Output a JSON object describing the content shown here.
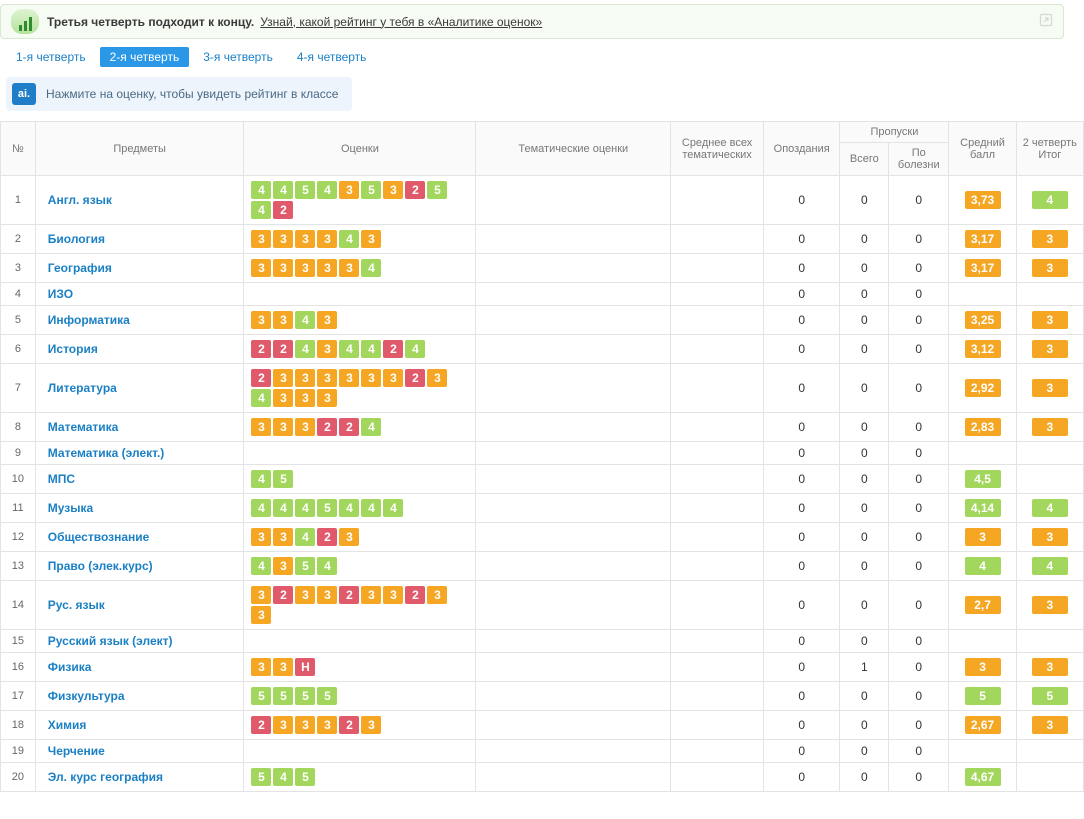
{
  "banner": {
    "title": "Третья четверть подходит к концу.",
    "link": "Узнай, какой рейтинг у тебя в «Аналитике оценок»"
  },
  "tabs": [
    "1-я четверть",
    "2-я четверть",
    "3-я четверть",
    "4-я четверть"
  ],
  "activeTab": 1,
  "tip": {
    "icon": "ai.",
    "text": "Нажмите на оценку, чтобы увидеть рейтинг в классе"
  },
  "headers": {
    "num": "№",
    "subjects": "Предметы",
    "marks": "Оценки",
    "thematic": "Тематические оценки",
    "avgThematic": "Среднее всех тематических",
    "late": "Опоздания",
    "absences": "Пропуски",
    "absTotal": "Всего",
    "absIll": "По болезни",
    "avg": "Средний балл",
    "final": "2 четверть Итог"
  },
  "rows": [
    {
      "n": 1,
      "subject": "Англ. язык",
      "marks": [
        "4",
        "4",
        "5",
        "4",
        "3",
        "5",
        "3",
        "2",
        "5",
        "4",
        "2"
      ],
      "late": 0,
      "absTotal": 0,
      "absIll": 0,
      "avg": "3,73",
      "avgColor": "orange",
      "final": "4",
      "finalColor": "green"
    },
    {
      "n": 2,
      "subject": "Биология",
      "marks": [
        "3",
        "3",
        "3",
        "3",
        "4",
        "3"
      ],
      "late": 0,
      "absTotal": 0,
      "absIll": 0,
      "avg": "3,17",
      "avgColor": "orange",
      "final": "3",
      "finalColor": "orange"
    },
    {
      "n": 3,
      "subject": "География",
      "marks": [
        "3",
        "3",
        "3",
        "3",
        "3",
        "4"
      ],
      "late": 0,
      "absTotal": 0,
      "absIll": 0,
      "avg": "3,17",
      "avgColor": "orange",
      "final": "3",
      "finalColor": "orange"
    },
    {
      "n": 4,
      "subject": "ИЗО",
      "marks": [],
      "late": 0,
      "absTotal": 0,
      "absIll": 0,
      "avg": "",
      "avgColor": "",
      "final": "",
      "finalColor": ""
    },
    {
      "n": 5,
      "subject": "Информатика",
      "marks": [
        "3",
        "3",
        "4",
        "3"
      ],
      "late": 0,
      "absTotal": 0,
      "absIll": 0,
      "avg": "3,25",
      "avgColor": "orange",
      "final": "3",
      "finalColor": "orange"
    },
    {
      "n": 6,
      "subject": "История",
      "marks": [
        "2",
        "2",
        "4",
        "3",
        "4",
        "4",
        "2",
        "4"
      ],
      "late": 0,
      "absTotal": 0,
      "absIll": 0,
      "avg": "3,12",
      "avgColor": "orange",
      "final": "3",
      "finalColor": "orange"
    },
    {
      "n": 7,
      "subject": "Литература",
      "marks": [
        "2",
        "3",
        "3",
        "3",
        "3",
        "3",
        "3",
        "2",
        "3",
        "4",
        "3",
        "3",
        "3"
      ],
      "late": 0,
      "absTotal": 0,
      "absIll": 0,
      "avg": "2,92",
      "avgColor": "orange",
      "final": "3",
      "finalColor": "orange"
    },
    {
      "n": 8,
      "subject": "Математика",
      "marks": [
        "3",
        "3",
        "3",
        "2",
        "2",
        "4"
      ],
      "late": 0,
      "absTotal": 0,
      "absIll": 0,
      "avg": "2,83",
      "avgColor": "orange",
      "final": "3",
      "finalColor": "orange"
    },
    {
      "n": 9,
      "subject": "Математика (элект.)",
      "marks": [],
      "late": 0,
      "absTotal": 0,
      "absIll": 0,
      "avg": "",
      "avgColor": "",
      "final": "",
      "finalColor": ""
    },
    {
      "n": 10,
      "subject": "МПС",
      "marks": [
        "4",
        "5"
      ],
      "late": 0,
      "absTotal": 0,
      "absIll": 0,
      "avg": "4,5",
      "avgColor": "green",
      "final": "",
      "finalColor": ""
    },
    {
      "n": 11,
      "subject": "Музыка",
      "marks": [
        "4",
        "4",
        "4",
        "5",
        "4",
        "4",
        "4"
      ],
      "late": 0,
      "absTotal": 0,
      "absIll": 0,
      "avg": "4,14",
      "avgColor": "green",
      "final": "4",
      "finalColor": "green"
    },
    {
      "n": 12,
      "subject": "Обществознание",
      "marks": [
        "3",
        "3",
        "4",
        "2",
        "3"
      ],
      "late": 0,
      "absTotal": 0,
      "absIll": 0,
      "avg": "3",
      "avgColor": "orange",
      "final": "3",
      "finalColor": "orange"
    },
    {
      "n": 13,
      "subject": "Право (элек.курс)",
      "marks": [
        "4",
        "3",
        "5",
        "4"
      ],
      "late": 0,
      "absTotal": 0,
      "absIll": 0,
      "avg": "4",
      "avgColor": "green",
      "final": "4",
      "finalColor": "green"
    },
    {
      "n": 14,
      "subject": "Рус. язык",
      "marks": [
        "3",
        "2",
        "3",
        "3",
        "2",
        "3",
        "3",
        "2",
        "3",
        "3"
      ],
      "late": 0,
      "absTotal": 0,
      "absIll": 0,
      "avg": "2,7",
      "avgColor": "orange",
      "final": "3",
      "finalColor": "orange"
    },
    {
      "n": 15,
      "subject": "Русский язык (элект)",
      "marks": [],
      "late": 0,
      "absTotal": 0,
      "absIll": 0,
      "avg": "",
      "avgColor": "",
      "final": "",
      "finalColor": ""
    },
    {
      "n": 16,
      "subject": "Физика",
      "marks": [
        "3",
        "3",
        "Н"
      ],
      "late": 0,
      "absTotal": 1,
      "absIll": 0,
      "avg": "3",
      "avgColor": "orange",
      "final": "3",
      "finalColor": "orange"
    },
    {
      "n": 17,
      "subject": "Физкультура",
      "marks": [
        "5",
        "5",
        "5",
        "5"
      ],
      "late": 0,
      "absTotal": 0,
      "absIll": 0,
      "avg": "5",
      "avgColor": "green",
      "final": "5",
      "finalColor": "green"
    },
    {
      "n": 18,
      "subject": "Химия",
      "marks": [
        "2",
        "3",
        "3",
        "3",
        "2",
        "3"
      ],
      "late": 0,
      "absTotal": 0,
      "absIll": 0,
      "avg": "2,67",
      "avgColor": "orange",
      "final": "3",
      "finalColor": "orange"
    },
    {
      "n": 19,
      "subject": "Черчение",
      "marks": [],
      "late": 0,
      "absTotal": 0,
      "absIll": 0,
      "avg": "",
      "avgColor": "",
      "final": "",
      "finalColor": ""
    },
    {
      "n": 20,
      "subject": "Эл. курс география",
      "marks": [
        "5",
        "4",
        "5"
      ],
      "late": 0,
      "absTotal": 0,
      "absIll": 0,
      "avg": "4,67",
      "avgColor": "green",
      "final": "",
      "finalColor": ""
    }
  ]
}
